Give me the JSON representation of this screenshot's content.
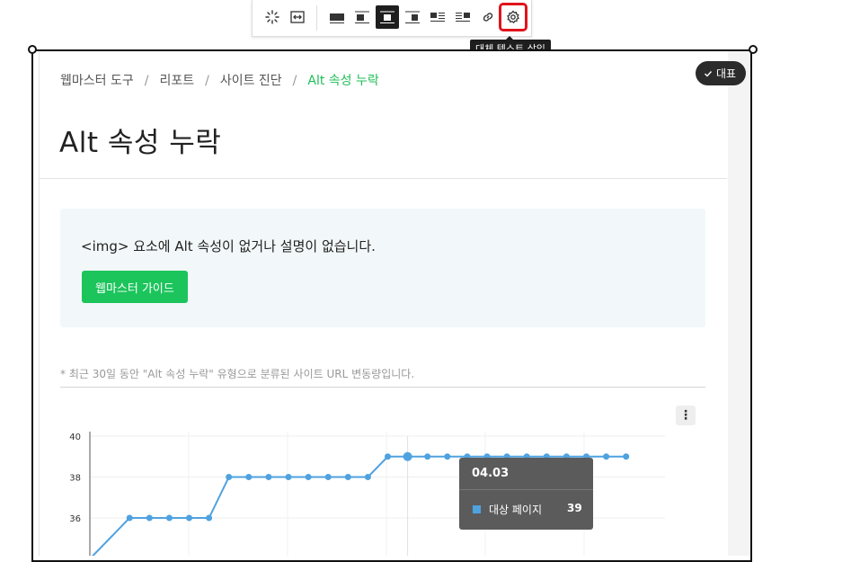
{
  "toolbar": {
    "tooltip": "대체 텍스트 삽입",
    "buttons": [
      "magic-icon",
      "resize-icon",
      "align-full-icon",
      "align-left-icon",
      "align-center-icon",
      "align-right-icon",
      "text-wrap-left-icon",
      "text-wrap-right-icon",
      "link-icon",
      "settings-icon"
    ]
  },
  "badge": {
    "label": "대표"
  },
  "breadcrumb": {
    "items": [
      "웹마스터 도구",
      "리포트",
      "사이트 진단",
      "Alt 속성 누락"
    ]
  },
  "page_title": "Alt 속성 누락",
  "info": {
    "text": "<img> 요소에 Alt 속성이 없거나 설명이 없습니다.",
    "button": "웹마스터 가이드"
  },
  "note": "* 최근 30일 동안 \"Alt 속성 누락\" 유형으로 분류된 사이트 URL 변동량입니다.",
  "tooltip": {
    "date": "04.03",
    "series": "대상 페이지",
    "value": "39"
  },
  "colors": {
    "accent": "#1cc45c",
    "line": "#4fa2e0",
    "highlight": "#e0141b"
  },
  "chart_data": {
    "type": "line",
    "y_ticks": [
      36,
      38,
      40
    ],
    "ylim": [
      34.3,
      40
    ],
    "series": [
      {
        "name": "대상 페이지",
        "values": [
          34,
          35,
          36,
          36,
          36,
          36,
          36,
          38,
          38,
          38,
          38,
          38,
          38,
          38,
          38,
          39,
          39,
          39,
          39,
          39,
          39,
          39,
          39,
          39,
          39,
          39,
          39,
          39
        ]
      }
    ],
    "highlight_index": 16,
    "grid": true
  }
}
